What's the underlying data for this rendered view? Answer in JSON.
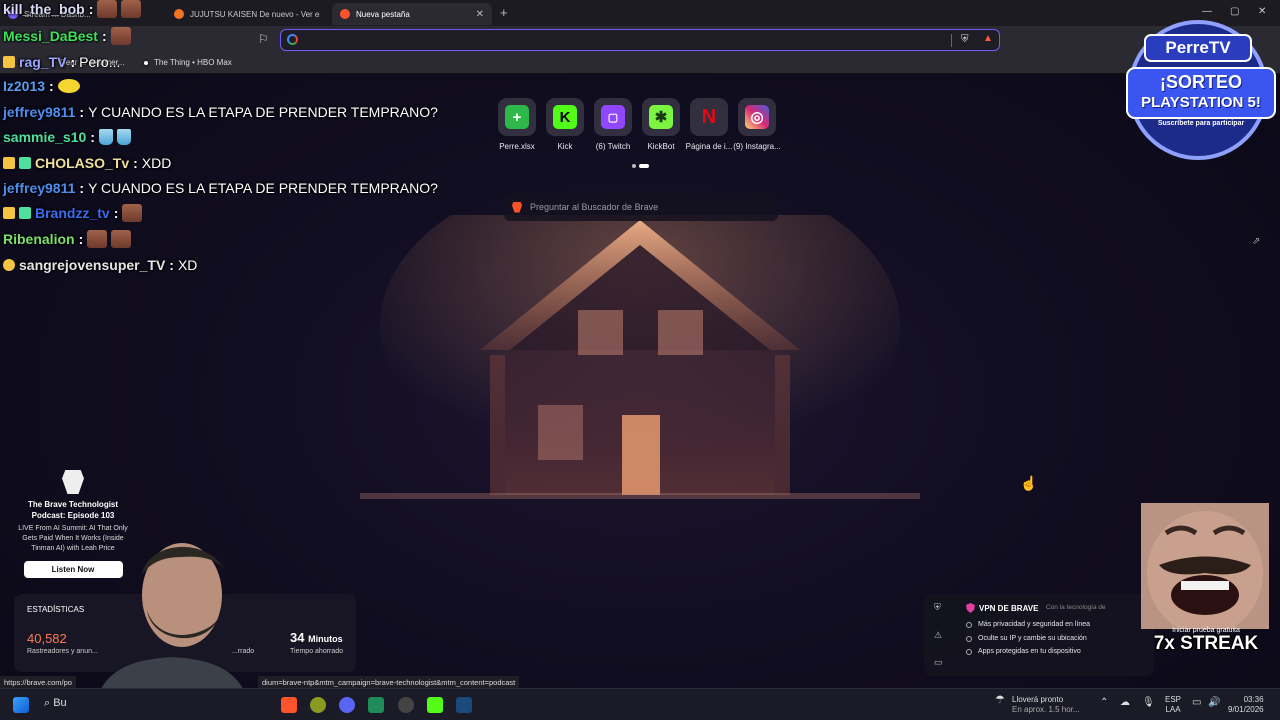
{
  "browser": {
    "tabs": [
      {
        "label": "Stream ... Dashb...",
        "color": "#7b5cff"
      },
      {
        "label": "JUJUTSU KAISEN De nuevo - Ver en C",
        "color": "#f47521"
      },
      {
        "label": "Nueva pestaña",
        "color": "#fb542b"
      }
    ],
    "new_tab": "+",
    "bookmarks": [
      {
        "label": "Dear ... dreamer..."
      },
      {
        "label": "The Thing • HBO Max"
      }
    ],
    "address_value": "",
    "ask_placeholder": "Preguntar al Buscador de Brave"
  },
  "shortcuts": [
    {
      "label": "Perre.xlsx",
      "icon": "plus-icon",
      "color": "#2fb84a",
      "glyph": "+"
    },
    {
      "label": "Kick",
      "icon": "kick-icon",
      "color": "#53fc18",
      "glyph": "K"
    },
    {
      "label": "(6) Twitch",
      "icon": "twitch-icon",
      "color": "#9146ff",
      "glyph": "▢"
    },
    {
      "label": "KickBot",
      "icon": "kickbot-icon",
      "color": "#7bf542",
      "glyph": "✱"
    },
    {
      "label": "Página de i...",
      "icon": "netflix-icon",
      "color": "#e50914",
      "glyph": "N"
    },
    {
      "label": "(9) Instagra...",
      "icon": "instagram-icon",
      "color": "#d62976",
      "glyph": "◎"
    }
  ],
  "chat": [
    {
      "user": "kill_the_bob",
      "color": "#d9d9f5",
      "text": "",
      "emotes": 2,
      "badge": ""
    },
    {
      "user": "Messi_DaBest",
      "color": "#3ee05a",
      "text": "",
      "emotes": 1,
      "badge": ""
    },
    {
      "user": "rag_TV",
      "color": "#9aa6ff",
      "text": "Pero...",
      "emotes": 0,
      "badge": "crown"
    },
    {
      "user": "Iz2013",
      "color": "#5a9cf5",
      "text": "",
      "emotes": 0,
      "emote": "yellow",
      "badge": ""
    },
    {
      "user": "jeffrey9811",
      "color": "#4d8ef0",
      "text": "Y CUANDO ES LA ETAPA DE PRENDER TEMPRANO?",
      "emotes": 0,
      "badge": ""
    },
    {
      "user": "sammie_s10",
      "color": "#4de0a0",
      "text": "",
      "emotes": 0,
      "emote": "cup",
      "badge": ""
    },
    {
      "user": "CHOLASO_Tv",
      "color": "#f0e0a0",
      "text": "XDD",
      "emotes": 0,
      "badge": "crown"
    },
    {
      "user": "jeffrey9811",
      "color": "#4d8ef0",
      "text": "Y CUANDO ES LA ETAPA DE PRENDER TEMPRANO?",
      "emotes": 0,
      "badge": ""
    },
    {
      "user": "Brandzz_tv",
      "color": "#3a6cf0",
      "text": "",
      "emotes": 1,
      "badge": "crown"
    },
    {
      "user": "Ribenalion",
      "color": "#7be06a",
      "text": "",
      "emotes": 2,
      "badge": ""
    },
    {
      "user": "sangrejovensuper_TV",
      "color": "#e5e5e5",
      "text": "XD",
      "emotes": 0,
      "badge": "coin"
    }
  ],
  "news": {
    "title": "The Brave Technologist Podcast: Episode 103",
    "subtitle": "LIVE From AI Summit: AI That Only Gets Paid When It Works (Inside Tinman AI) with Leah Price",
    "button": "Listen Now"
  },
  "stats": {
    "heading": "ESTADÍSTICAS",
    "trackers_value": "40,582",
    "trackers_label": "Rastreadores y anun...",
    "bandwidth_label": "...rrado",
    "time_value": "34",
    "time_unit": "Minutos",
    "time_label": "Tiempo ahorrado"
  },
  "vpn": {
    "title": "VPN DE BRAVE",
    "powered": "Con la tecnología de",
    "items": [
      "Más privacidad y seguridad en línea",
      "Oculte su IP y cambie su ubicación",
      "Apps protegidas en tu dispositivo"
    ],
    "trial": "Iniciar prueba gratuita"
  },
  "overlay": {
    "brand": "PerreTV",
    "sorteo1": "¡SORTEO",
    "sorteo2": "PLAYSTATION 5!",
    "sorteo_sub": "Suscríbete para participar",
    "streak": "7x STREAK"
  },
  "status_url_left": "https://brave.com/po",
  "status_url_right": "dium=brave-ntp&mtm_campaign=brave-technologist&mtm_content=podcast",
  "taskbar": {
    "search": "Bu",
    "weather_title": "Lloverá pronto",
    "weather_sub": "En aprox. 1.5 hor...",
    "lang1": "ESP",
    "lang2": "LAA",
    "time": "03:36",
    "date": "9/01/2026"
  }
}
